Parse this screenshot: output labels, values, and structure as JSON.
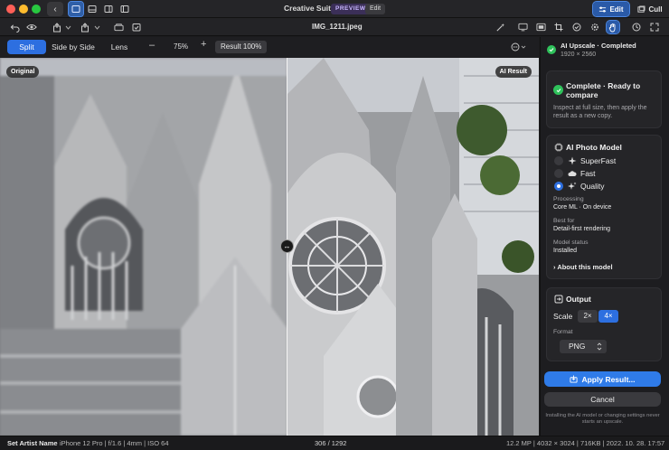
{
  "window": {
    "title": "Creative Suite",
    "badge": "PREVIEW",
    "edit_chip": "Edit",
    "mode_edit": "Edit",
    "mode_cull": "Cull"
  },
  "toolbar": {
    "filename": "IMG_1211.jpeg"
  },
  "compare": {
    "modes": [
      "Split",
      "Side by Side",
      "Lens"
    ],
    "active_mode": "Split",
    "zoom": "75%",
    "result_button": "Result 100%"
  },
  "canvas": {
    "label_original": "Original",
    "label_ai": "AI Result"
  },
  "panel": {
    "job": {
      "title": "AI Upscale · Completed",
      "subtitle": "1920 × 2560"
    },
    "complete": {
      "title": "Complete · Ready to compare",
      "body": "Inspect at full size, then apply the result as a new copy."
    },
    "model": {
      "heading": "AI Photo Model",
      "options": [
        {
          "label": "SuperFast",
          "selected": false,
          "icon": "sparkle-icon"
        },
        {
          "label": "Fast",
          "selected": false,
          "icon": "cloud-icon"
        },
        {
          "label": "Quality",
          "selected": true,
          "icon": "sparkles-icon"
        }
      ],
      "processing_label": "Processing",
      "processing_value": "Core ML · On device",
      "best_for_label": "Best for",
      "best_for_value": "Detail-first rendering",
      "status_label": "Model status",
      "status_value": "Installed",
      "about_link": "About this model"
    },
    "output": {
      "heading": "Output",
      "scale_label": "Scale",
      "scales": [
        "2×",
        "4×"
      ],
      "selected_scale": "4×",
      "format_label": "Format",
      "format_value": "PNG"
    },
    "apply_button": "Apply Result...",
    "cancel_button": "Cancel",
    "footnote": "Installing the AI model or changing settings never starts an upscale."
  },
  "statusbar": {
    "artist": "Set Artist Name",
    "meta": "iPhone 12 Pro  |  f/1.6  |  4mm  |  ISO 64",
    "count": "306 / 1292",
    "right": "12.2 MP  |  4032 × 3024  |  716KB  |  2022. 10. 28. 17:57"
  },
  "colors": {
    "accent": "#2d6fe0",
    "success": "#2fc25b",
    "panel_bg": "#1d1d20",
    "card_bg": "#252528"
  }
}
